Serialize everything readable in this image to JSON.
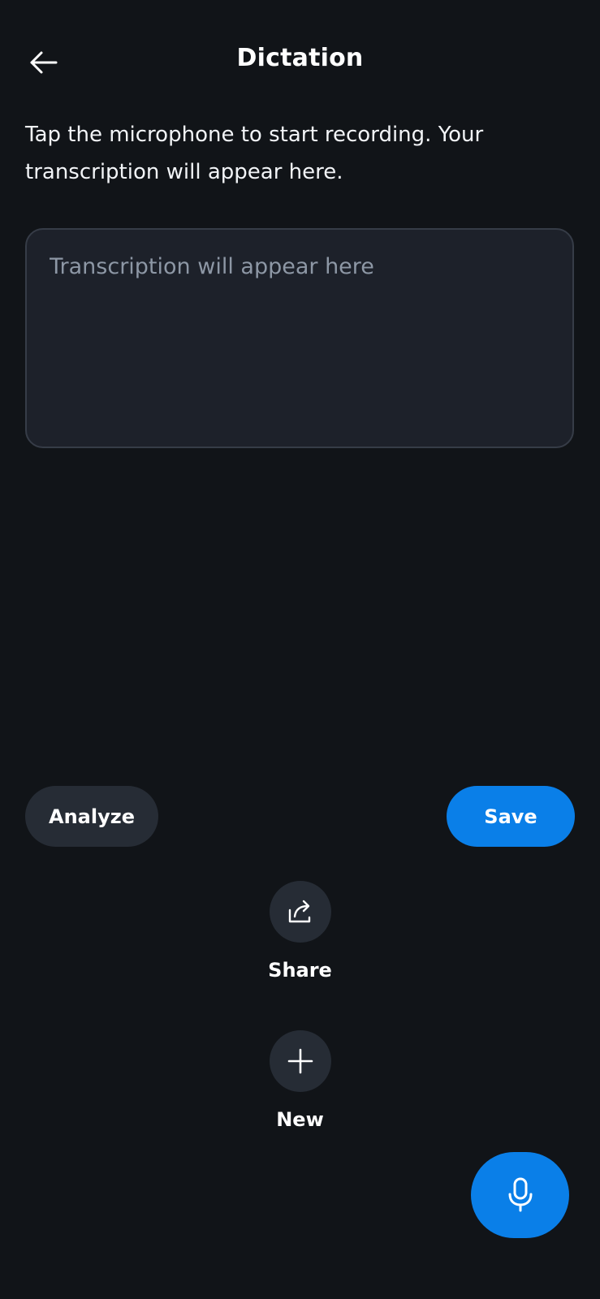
{
  "header": {
    "title": "Dictation",
    "back_icon": "arrow-left-icon"
  },
  "instructions": "Tap the microphone to start recording. Your transcription will appear here.",
  "transcript": {
    "value": "",
    "placeholder": "Transcription will appear here"
  },
  "buttons": {
    "analyze": "Analyze",
    "save": "Save"
  },
  "actions": {
    "share": {
      "label": "Share",
      "icon": "share-icon"
    },
    "new": {
      "label": "New",
      "icon": "plus-icon"
    }
  },
  "fab": {
    "icon": "microphone-icon"
  },
  "colors": {
    "background": "#111418",
    "accent": "#0a7fe8",
    "secondary_button": "#262c35",
    "field_background": "#1d212a",
    "field_border": "#363c47",
    "placeholder": "#8d97a5"
  }
}
